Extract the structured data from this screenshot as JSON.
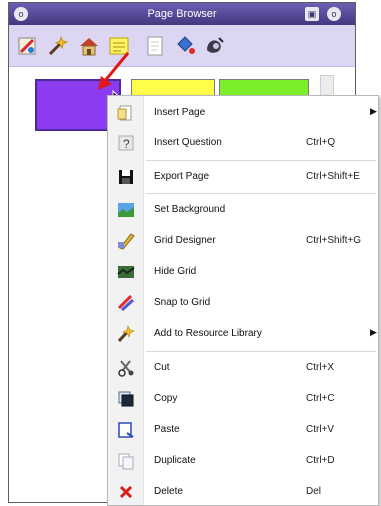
{
  "window": {
    "title": "Page Browser",
    "left_button": "o",
    "right_buttons": [
      "▣",
      "o"
    ]
  },
  "toolbar": {
    "icons": [
      "paint-icon",
      "magic-wand-icon",
      "house-icon",
      "sticky-note-icon",
      "page-icon",
      "paint-bucket-icon",
      "camera-icon"
    ]
  },
  "pages": {
    "thumbnails": [
      {
        "color": "#8c3cef"
      },
      {
        "color": "#ffff4a"
      },
      {
        "color": "#7bf02a"
      }
    ]
  },
  "context_menu": {
    "items": [
      {
        "label": "Insert Page",
        "shortcut": "",
        "submenu": true,
        "icon": "insert-page-icon"
      },
      {
        "label": "Insert Question",
        "shortcut": "Ctrl+Q",
        "submenu": false,
        "icon": "question-icon"
      },
      {
        "label": "Export Page",
        "shortcut": "Ctrl+Shift+E",
        "submenu": false,
        "icon": "export-icon"
      },
      {
        "label": "Set Background",
        "shortcut": "",
        "submenu": false,
        "icon": "background-icon"
      },
      {
        "label": "Grid Designer",
        "shortcut": "Ctrl+Shift+G",
        "submenu": false,
        "icon": "grid-designer-icon"
      },
      {
        "label": "Hide Grid",
        "shortcut": "",
        "submenu": false,
        "icon": "hide-grid-icon"
      },
      {
        "label": "Snap to Grid",
        "shortcut": "",
        "submenu": false,
        "icon": "snap-icon"
      },
      {
        "label": "Add to Resource Library",
        "shortcut": "",
        "submenu": true,
        "icon": "resource-library-icon"
      },
      {
        "label": "Cut",
        "shortcut": "Ctrl+X",
        "submenu": false,
        "icon": "cut-icon"
      },
      {
        "label": "Copy",
        "shortcut": "Ctrl+C",
        "submenu": false,
        "icon": "copy-icon"
      },
      {
        "label": "Paste",
        "shortcut": "Ctrl+V",
        "submenu": false,
        "icon": "paste-icon"
      },
      {
        "label": "Duplicate",
        "shortcut": "Ctrl+D",
        "submenu": false,
        "icon": "duplicate-icon"
      },
      {
        "label": "Delete",
        "shortcut": "Del",
        "submenu": false,
        "icon": "delete-icon"
      }
    ],
    "submenu_glyph": "▶"
  },
  "colors": {
    "title_bar": "#4f4592",
    "toolbar": "#dcd6f2",
    "annotation_arrow": "#e01818"
  }
}
